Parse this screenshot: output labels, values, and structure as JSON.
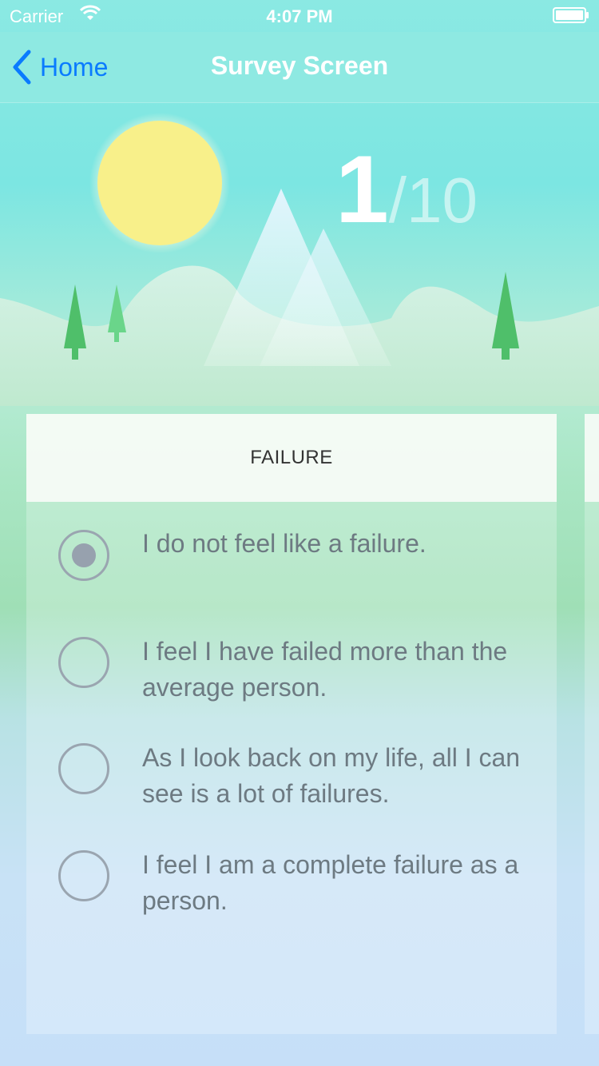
{
  "status": {
    "carrier": "Carrier",
    "time": "4:07 PM"
  },
  "nav": {
    "back_label": "Home",
    "title": "Survey Screen"
  },
  "progress": {
    "current": "1",
    "total": "/10"
  },
  "card": {
    "heading": "FAILURE",
    "options": [
      {
        "label": "I do not feel like a failure.",
        "selected": true
      },
      {
        "label": "I feel I have failed more than the average person.",
        "selected": false
      },
      {
        "label": "As I look back on my life, all I can see is a lot of failures.",
        "selected": false
      },
      {
        "label": "I feel I am a complete failure as a person.",
        "selected": false
      }
    ]
  },
  "colors": {
    "accent": "#0a7bff",
    "nav_bg": "#8ee9e2",
    "sun": "#f8f08a",
    "tree": "#4fbf6a"
  }
}
